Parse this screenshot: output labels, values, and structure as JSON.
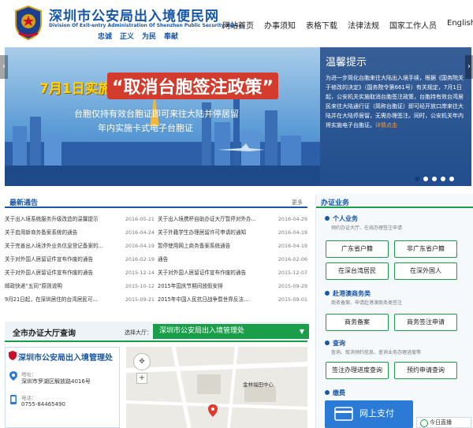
{
  "header": {
    "title": "深圳市公安局出入境便民网",
    "subtitle": "Division Of Exit-entry Administration Of Shenzhen Public Security Bureau",
    "slogans": [
      "忠诚",
      "正义",
      "为民",
      "奉献"
    ],
    "nav": [
      "网站首页",
      "办事须知",
      "表格下载",
      "法律法规",
      "国家工作人员",
      "English"
    ]
  },
  "banner": {
    "prefix": "7月1日实施",
    "title": "“取消台胞签注政策”",
    "line1": "台胞仅持有效台胞证即可来往大陆并停居留",
    "line2": "年内实施卡式电子台胞证",
    "notice_title": "温馨提示",
    "notice_body": "为进一步简化台胞来往大陆出入境手续，根据《国务院关于修改的决定》（国务院令第661号）有关规定，7月1日起，公安机关实施取消台胞签注政策，台胞持有效台湾居民来往大陆通行证（简称台胞证）即可经开放口岸来往大陆并在大陆停居留，无需办理签注。同时，公安机关年内将实施电子台胞证。",
    "notice_more": "详情点击",
    "dots": 5,
    "active_dot": 0
  },
  "news": {
    "title": "最新通告",
    "more": "更多",
    "items": [
      {
        "title": "关于出入境系统服务升级改造的温馨提示",
        "date": "2016-05-21"
      },
      {
        "title": "关于出入境携杯自助办证大厅暂停对外办...",
        "date": "2016-04-29"
      },
      {
        "title": "关于启用新商务备案系统的通告",
        "date": "2016-04-24"
      },
      {
        "title": "关于外籍学生办理居留许可申请的通知",
        "date": "2016-04-19"
      },
      {
        "title": "关于完善出入境涉外业务信息登记备案的...",
        "date": "2016-04-19"
      },
      {
        "title": "暂停使用网上商务备案系统通告",
        "date": "2016-04-19"
      },
      {
        "title": "关于对外国人居留证件宣布作废的通告",
        "date": "2016-02-19"
      },
      {
        "title": "通告",
        "date": "2016-02-06"
      },
      {
        "title": "关于对外国人居留证件宣布作废的通告",
        "date": "2015-12-14"
      },
      {
        "title": "关于对外国人居留证件宣布作废的通告",
        "date": "2015-12-07"
      },
      {
        "title": "邮政快递“五同”原则说明",
        "date": "2015-10-12"
      },
      {
        "title": "2015年国庆节期间放假安排",
        "date": "2015-09-29"
      },
      {
        "title": "9月21日起，在深圳居住的台湾居民可...",
        "date": "2015-09-21"
      },
      {
        "title": "2015年中国人民抗日战争暨世界反法...",
        "date": "2015-09-01"
      }
    ]
  },
  "hall": {
    "title": "全市办证大厅查询",
    "select_label": "选择大厅：",
    "selected": "深圳市公安局出入境管理处",
    "info_title": "深圳市公安局出入境管理处",
    "addr_label": "地址：",
    "addr": "深圳市罗湖区解放路4016号",
    "phone_label": "电话：",
    "phone": "0755-84465490",
    "map_label": "金林福田中心"
  },
  "services": {
    "title": "办证业务",
    "categories": [
      {
        "name": "个人业务",
        "desc": "预约办证大厅、在线办理签注申请",
        "buttons": [
          "广东省户籍",
          "非广东省户籍",
          "在深台湾居民",
          "在深外国人"
        ]
      },
      {
        "name": "赴港澳商务类",
        "desc": "商务备案、申请赴港澳商务类签注",
        "buttons": [
          "商务备案",
          "商务签注申请"
        ]
      },
      {
        "name": "查询",
        "desc": "查询、取消预约信息、查询业务办理进度等",
        "buttons": [
          "签注办理进度查询",
          "预约申请查询"
        ]
      },
      {
        "name": "缴费",
        "desc": "",
        "buttons": []
      }
    ],
    "pay_label": "网上支付"
  },
  "live": "今日直播"
}
